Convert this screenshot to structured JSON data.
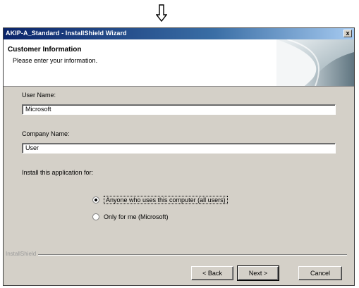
{
  "window": {
    "title": "AKIP-A_Standard - InstallShield Wizard",
    "close_glyph": "x"
  },
  "banner": {
    "heading": "Customer Information",
    "subtitle": "Please enter your information."
  },
  "form": {
    "user_name_label": "User Name:",
    "user_name_value": "Microsoft",
    "company_name_label": "Company Name:",
    "company_name_value": "User",
    "install_for_label": "Install this application for:",
    "options": [
      {
        "label": "Anyone who uses this computer (all users)",
        "selected": true
      },
      {
        "label": "Only for me (Microsoft)",
        "selected": false
      }
    ]
  },
  "footer": {
    "brand": "InstallShield",
    "back_label": "< Back",
    "next_label": "Next >",
    "cancel_label": "Cancel"
  },
  "icons": {
    "arrow": "down-arrow-icon",
    "banner": "page-curl-graphic"
  },
  "colors": {
    "titlebar_start": "#0a246a",
    "titlebar_end": "#a6caf0",
    "dialog_bg": "#d4d0c8"
  }
}
